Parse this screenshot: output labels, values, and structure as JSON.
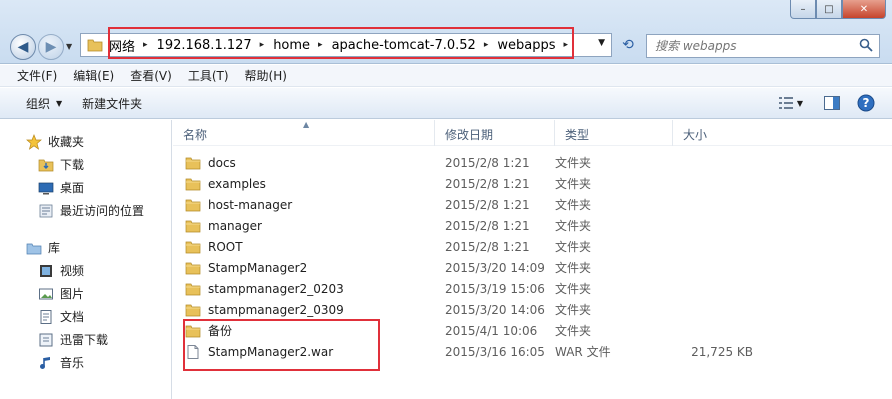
{
  "window": {
    "minimize_glyph": "–",
    "maximize_glyph": "□",
    "close_glyph": "✕"
  },
  "address": {
    "crumbs": [
      "网络",
      "192.168.1.127",
      "home",
      "apache-tomcat-7.0.52",
      "webapps"
    ],
    "separator": "▸"
  },
  "search": {
    "placeholder": "搜索 webapps"
  },
  "menu": [
    "文件(F)",
    "编辑(E)",
    "查看(V)",
    "工具(T)",
    "帮助(H)"
  ],
  "commands": {
    "organize": "组织",
    "new_folder": "新建文件夹"
  },
  "nav": {
    "favorites": {
      "title": "收藏夹",
      "items": [
        "下载",
        "桌面",
        "最近访问的位置"
      ]
    },
    "libraries": {
      "title": "库",
      "items": [
        "视频",
        "图片",
        "文档",
        "迅雷下载",
        "音乐"
      ]
    }
  },
  "columns": {
    "name": "名称",
    "date": "修改日期",
    "type": "类型",
    "size": "大小"
  },
  "files": [
    {
      "name": "docs",
      "date": "2015/2/8 1:21",
      "type": "文件夹",
      "size": "",
      "kind": "folder"
    },
    {
      "name": "examples",
      "date": "2015/2/8 1:21",
      "type": "文件夹",
      "size": "",
      "kind": "folder"
    },
    {
      "name": "host-manager",
      "date": "2015/2/8 1:21",
      "type": "文件夹",
      "size": "",
      "kind": "folder"
    },
    {
      "name": "manager",
      "date": "2015/2/8 1:21",
      "type": "文件夹",
      "size": "",
      "kind": "folder"
    },
    {
      "name": "ROOT",
      "date": "2015/2/8 1:21",
      "type": "文件夹",
      "size": "",
      "kind": "folder"
    },
    {
      "name": "StampManager2",
      "date": "2015/3/20 14:09",
      "type": "文件夹",
      "size": "",
      "kind": "folder"
    },
    {
      "name": "stampmanager2_0203",
      "date": "2015/3/19 15:06",
      "type": "文件夹",
      "size": "",
      "kind": "folder"
    },
    {
      "name": "stampmanager2_0309",
      "date": "2015/3/20 14:06",
      "type": "文件夹",
      "size": "",
      "kind": "folder"
    },
    {
      "name": "备份",
      "date": "2015/4/1 10:06",
      "type": "文件夹",
      "size": "",
      "kind": "folder"
    },
    {
      "name": "StampManager2.war",
      "date": "2015/3/16 16:05",
      "type": "WAR 文件",
      "size": "21,725 KB",
      "kind": "file"
    }
  ],
  "colors": {
    "highlight": "#e0303a",
    "folder": "#e8c15a"
  }
}
